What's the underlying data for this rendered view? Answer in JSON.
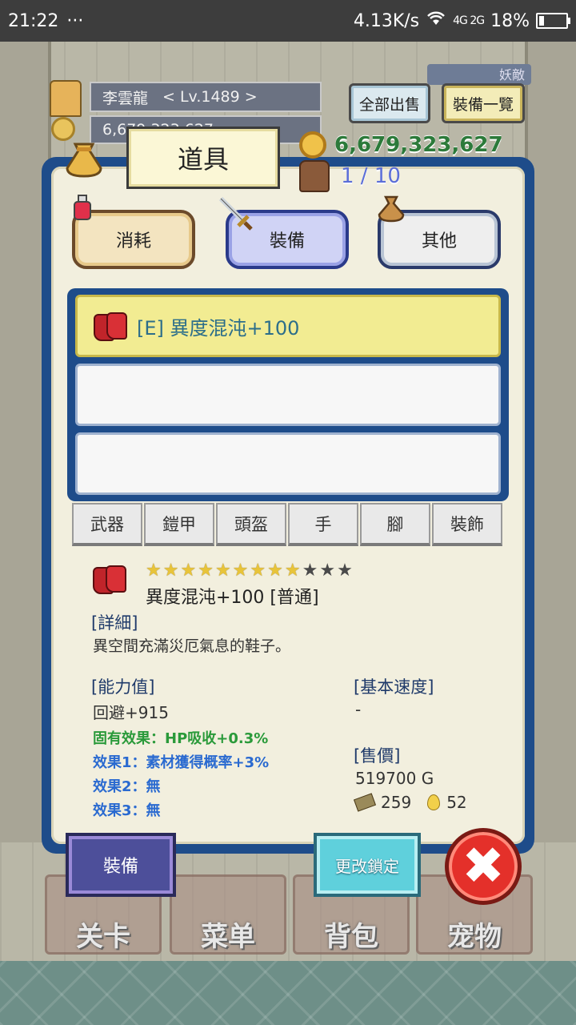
{
  "status_bar": {
    "time": "21:22",
    "dots": "···",
    "speed": "4.13K/s",
    "network": "4G 2G",
    "battery": "18%"
  },
  "header": {
    "player_name": "李雲龍",
    "level": "< Lv.1489 >",
    "gold_partial": "6,679,323,627",
    "enemy_tag": "妖敵",
    "sell_all_button": "全部出售",
    "equip_list_button": "裝備一覽"
  },
  "panel": {
    "title": "道具",
    "gold": "6,679,323,627",
    "capacity": "1 / 10"
  },
  "categories": [
    {
      "label": "消耗",
      "icon": "potion-icon"
    },
    {
      "label": "裝備",
      "icon": "sword-icon"
    },
    {
      "label": "其他",
      "icon": "sack-icon"
    }
  ],
  "item_list": [
    {
      "label": "[E] 異度混沌+100",
      "icon": "boots-icon"
    },
    {
      "label": ""
    },
    {
      "label": ""
    }
  ],
  "slot_tabs": [
    "武器",
    "鎧甲",
    "頭盔",
    "手",
    "腳",
    "裝飾"
  ],
  "detail": {
    "stars_filled": 9,
    "stars_total": 12,
    "star_char": "★",
    "item_name": "異度混沌+100 [普通]",
    "detail_label": "[詳細]",
    "description": "異空間充滿災厄氣息的鞋子。",
    "stats_label": "[能力值]",
    "stat_evasion": "回避+915",
    "inherent_effect": "固有效果：HP吸收+0.3%",
    "effect1": "效果1：素材獲得概率+3%",
    "effect2": "效果2：無",
    "effect3": "效果3：無",
    "speed_label": "[基本速度]",
    "speed_value": "-",
    "price_label": "[售價]",
    "price_value": "519700 G",
    "material_count": "259",
    "essence_count": "52"
  },
  "buttons": {
    "equip": "裝備",
    "change_lock": "更改鎖定",
    "close": "✖"
  },
  "bottom_nav": [
    "关卡",
    "菜单",
    "背包",
    "宠物"
  ],
  "colors": {
    "panel_border": "#1e4c8a",
    "selected_item": "#f2ec92",
    "gold_text": "#2c7a3a",
    "capacity_text": "#5b6ed8",
    "inherent_effect": "#2a9a3a",
    "effect_text": "#2a6ad0",
    "close_button": "#e4302a"
  }
}
